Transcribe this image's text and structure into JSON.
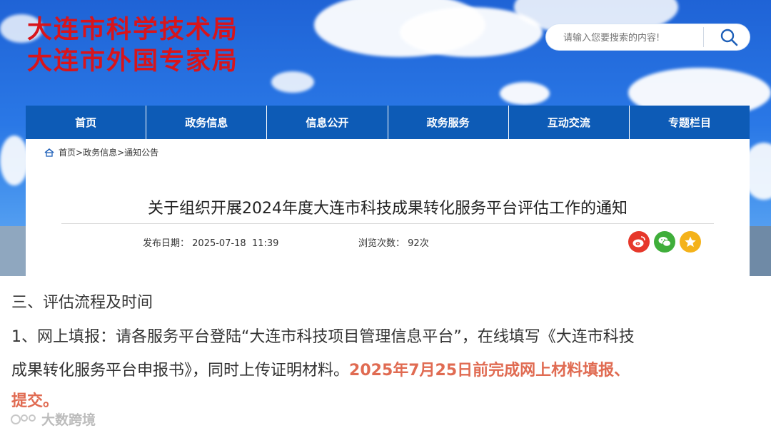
{
  "header": {
    "org_line1": "大连市科学技术局",
    "org_line2": "大连市外国专家局"
  },
  "search": {
    "placeholder": "请输入您要搜索的内容!",
    "icon": "search-icon"
  },
  "nav": {
    "items": [
      "首页",
      "政务信息",
      "信息公开",
      "政务服务",
      "互动交流",
      "专题栏目"
    ]
  },
  "breadcrumb": {
    "home": "首页",
    "sep1": ">",
    "level2": "政务信息",
    "sep2": ">",
    "level3": "通知公告"
  },
  "article": {
    "title": "关于组织开展2024年度大连市科技成果转化服务平台评估工作的通知",
    "date_label": "发布日期：",
    "date_value": "2025-07-18  11:39",
    "views_label": "浏览次数：",
    "views_value": "92次"
  },
  "share": {
    "icons": [
      "weibo-icon",
      "wechat-icon",
      "favorite-icon"
    ],
    "colors": {
      "weibo": "#e6372a",
      "wechat": "#3fae3a",
      "favorite": "#f4b21a"
    }
  },
  "content": {
    "heading": "三、评估流程及时间",
    "para_line1": "1、网上填报：请各服务平台登陆“大连市科技项目管理信息平台”，在线填写《大连市科技",
    "para_line2_normal": "成果转化服务平台申报书》，同时上传证明材料。",
    "para_line2_highlight": "2025年7月25日前完成网上材料填报、",
    "para_line3_highlight": "提交。"
  },
  "watermark": {
    "text": "大数跨境"
  },
  "colors": {
    "nav_bg": "#0d5bb6",
    "logo_red": "#d8141b",
    "highlight": "#e06b52"
  }
}
